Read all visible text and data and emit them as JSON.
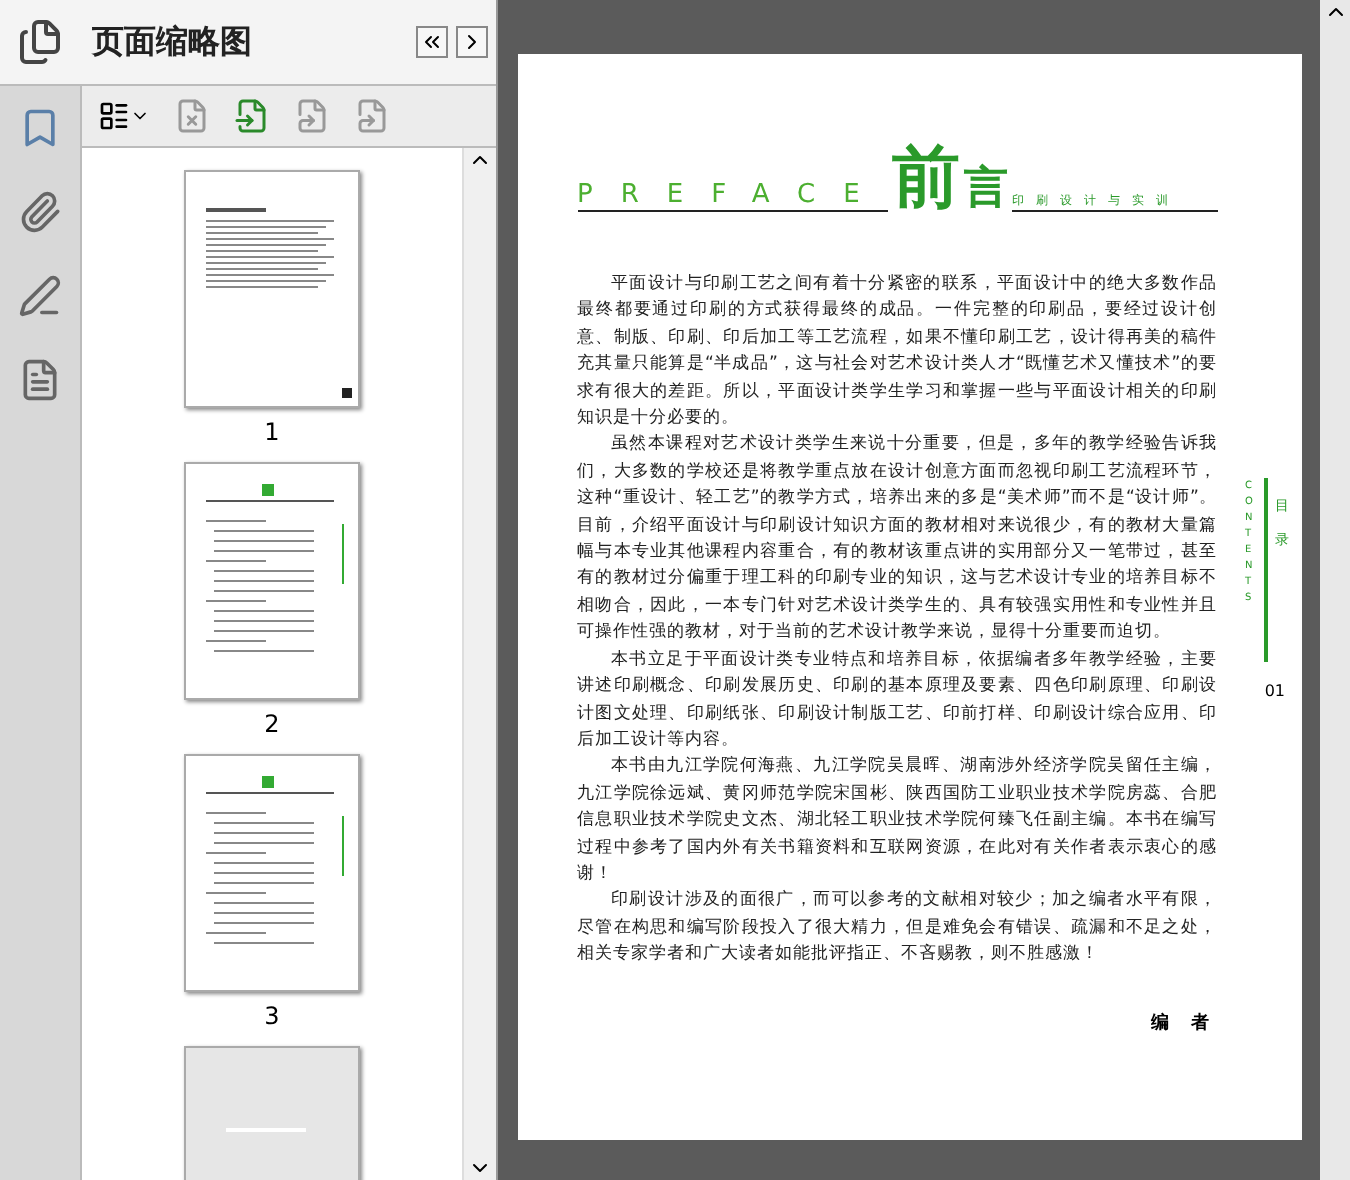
{
  "panel": {
    "title": "页面缩略图"
  },
  "thumbnails": [
    {
      "label": "1",
      "kind": "cover"
    },
    {
      "label": "2",
      "kind": "contents"
    },
    {
      "label": "3",
      "kind": "contents"
    },
    {
      "kind": "partial"
    }
  ],
  "document": {
    "heading": {
      "big": "前",
      "small": "言",
      "latin": "PREFACE",
      "subtitle": "印刷设计与实训"
    },
    "paragraphs": [
      "平面设计与印刷工艺之间有着十分紧密的联系，平面设计中的绝大多数作品最终都要通过印刷的方式获得最终的成品。一件完整的印刷品，要经过设计创意、制版、印刷、印后加工等工艺流程，如果不懂印刷工艺，设计得再美的稿件充其量只能算是“半成品”，这与社会对艺术设计类人才“既懂艺术又懂技术”的要求有很大的差距。所以，平面设计类学生学习和掌握一些与平面设计相关的印刷知识是十分必要的。",
      "虽然本课程对艺术设计类学生来说十分重要，但是，多年的教学经验告诉我们，大多数的学校还是将教学重点放在设计创意方面而忽视印刷工艺流程环节，这种“重设计、轻工艺”的教学方式，培养出来的多是“美术师”而不是“设计师”。目前，介绍平面设计与印刷设计知识方面的教材相对来说很少，有的教材大量篇幅与本专业其他课程内容重合，有的教材该重点讲的实用部分又一笔带过，甚至有的教材过分偏重于理工科的印刷专业的知识，这与艺术设计专业的培养目标不相吻合，因此，一本专门针对艺术设计类学生的、具有较强实用性和专业性并且可操作性强的教材，对于当前的艺术设计教学来说，显得十分重要而迫切。",
      "本书立足于平面设计类专业特点和培养目标，依据编者多年教学经验，主要讲述印刷概念、印刷发展历史、印刷的基本原理及要素、四色印刷原理、印刷设计图文处理、印刷纸张、印刷设计制版工艺、印前打样、印刷设计综合应用、印后加工设计等内容。",
      "本书由九江学院何海燕、九江学院吴晨晖、湖南涉外经济学院吴留任主编，九江学院徐远斌、黄冈师范学院宋国彬、陕西国防工业职业技术学院房蕊、合肥信息职业技术学院史文杰、湖北轻工职业技术学院何臻飞任副主编。本书在编写过程中参考了国内外有关书籍资料和互联网资源，在此对有关作者表示衷心的感谢！",
      "印刷设计涉及的面很广，而可以参考的文献相对较少；加之编者水平有限，尽管在构思和编写阶段投入了很大精力，但是难免会有错误、疏漏和不足之处，相关专家学者和广大读者如能批评指正、不吝赐教，则不胜感激！"
    ],
    "signature": "编 者",
    "side_tab": {
      "cn": "目录",
      "en": "CONTENTS"
    },
    "page_number": "01"
  }
}
